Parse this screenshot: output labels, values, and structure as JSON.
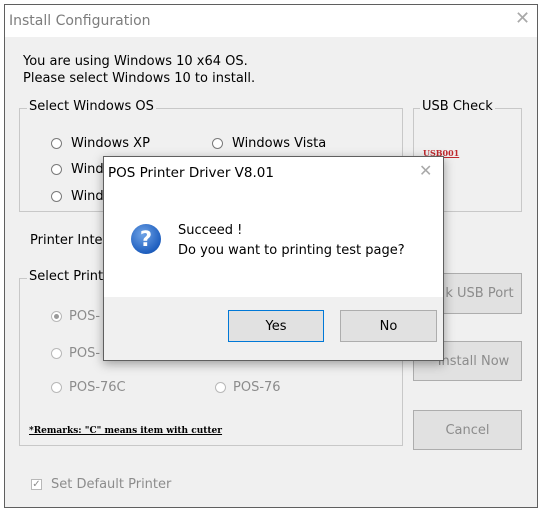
{
  "window": {
    "title": "Install Configuration",
    "close_glyph": "✕"
  },
  "info": {
    "line1": "You are using Windows 10 x64 OS.",
    "line2": "Please select Windows 10 to install."
  },
  "os_group": {
    "legend": "Select Windows OS",
    "options": [
      "Windows XP",
      "Windows Vista",
      "Wind",
      "Wind"
    ]
  },
  "usb_group": {
    "legend": "USB Check",
    "port": "USB001"
  },
  "printer_interface": {
    "label": "Printer Inte"
  },
  "printer_group": {
    "legend": "Select Printe",
    "options": [
      "POS-",
      "POS-",
      "POS-76C",
      "POS-76"
    ],
    "selected_index": 0
  },
  "remark": "*Remarks: \"C\" means item with cutter",
  "set_default": {
    "label": "Set Default Printer",
    "checked": true
  },
  "buttons": {
    "check_usb": "k USB Port",
    "install_now": "Install Now",
    "cancel": "Cancel"
  },
  "dialog": {
    "title": "POS Printer Driver V8.01",
    "close_glyph": "✕",
    "icon": "question-icon",
    "icon_glyph": "?",
    "message1": "Succeed !",
    "message2": "Do you want to printing test page?",
    "yes": "Yes",
    "no": "No"
  },
  "colors": {
    "accent": "#0078d7",
    "usb_port": "#c0282d",
    "disabled_text": "#8c8c8c"
  }
}
